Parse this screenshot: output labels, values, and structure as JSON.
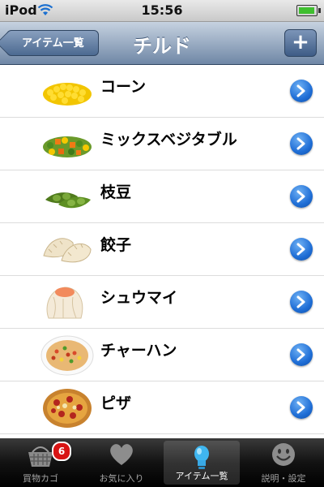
{
  "status_bar": {
    "carrier": "iPod",
    "time": "15:56"
  },
  "nav_bar": {
    "back_label": "アイテム一覧",
    "title": "チルド",
    "add_label": "+"
  },
  "items": [
    {
      "label": "コーン",
      "icon": "corn-icon"
    },
    {
      "label": "ミックスベジタブル",
      "icon": "mixed-vegetables-icon"
    },
    {
      "label": "枝豆",
      "icon": "edamame-icon"
    },
    {
      "label": "餃子",
      "icon": "gyoza-icon"
    },
    {
      "label": "シュウマイ",
      "icon": "shumai-icon"
    },
    {
      "label": "チャーハン",
      "icon": "fried-rice-icon"
    },
    {
      "label": "ピザ",
      "icon": "pizza-icon"
    }
  ],
  "tabs": [
    {
      "label": "買物カゴ",
      "icon": "basket-icon",
      "badge": "6"
    },
    {
      "label": "お気に入り",
      "icon": "heart-icon"
    },
    {
      "label": "アイテム一覧",
      "icon": "lightbulb-icon",
      "selected": true
    },
    {
      "label": "説明・設定",
      "icon": "smiley-icon"
    }
  ],
  "colors": {
    "nav_top": "#c6d2e0",
    "nav_bottom": "#6f87a6",
    "disclosure": "#1f6ed6",
    "badge": "#d81414"
  }
}
